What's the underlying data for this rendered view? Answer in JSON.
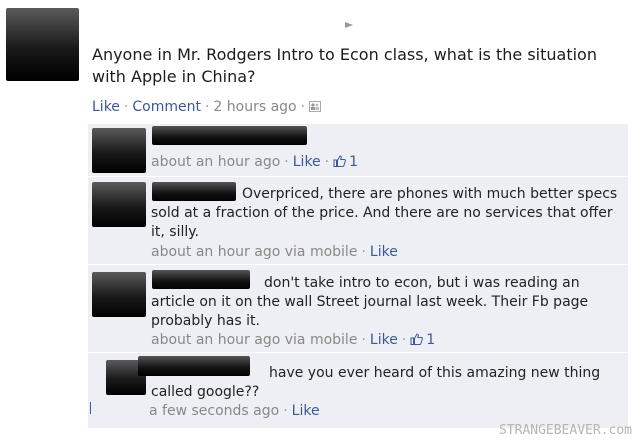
{
  "post": {
    "text": "Anyone in Mr. Rodgers Intro to Econ class, what is the situation with Apple in China?",
    "actions": {
      "like": "Like",
      "comment": "Comment",
      "time": "2 hours ago"
    }
  },
  "comments": [
    {
      "text": "",
      "time": "about an hour ago",
      "like": "Like",
      "like_count": "1"
    },
    {
      "text": "Overpriced, there are phones with much better specs sold at a fraction of the price. And there are no services that offer it, silly.",
      "time": "about an hour ago via mobile",
      "like": "Like"
    },
    {
      "text": "don't take intro to econ, but i was reading an article on it on the wall Street journal last week. Their Fb page probably has it.",
      "time": "about an hour ago via mobile",
      "like": "Like",
      "like_count": "1"
    },
    {
      "text": "have you ever heard of this amazing new thing called google??",
      "time": "a few seconds ago",
      "like": "Like"
    }
  ],
  "watermark": "STRANGEBEAVER.com",
  "colors": {
    "link": "#3b5998",
    "comment_bg": "#edeff4",
    "meta": "#888888"
  },
  "icons": {
    "post_audience": "people-icon",
    "thumbs_up": "thumbs-up-icon"
  }
}
